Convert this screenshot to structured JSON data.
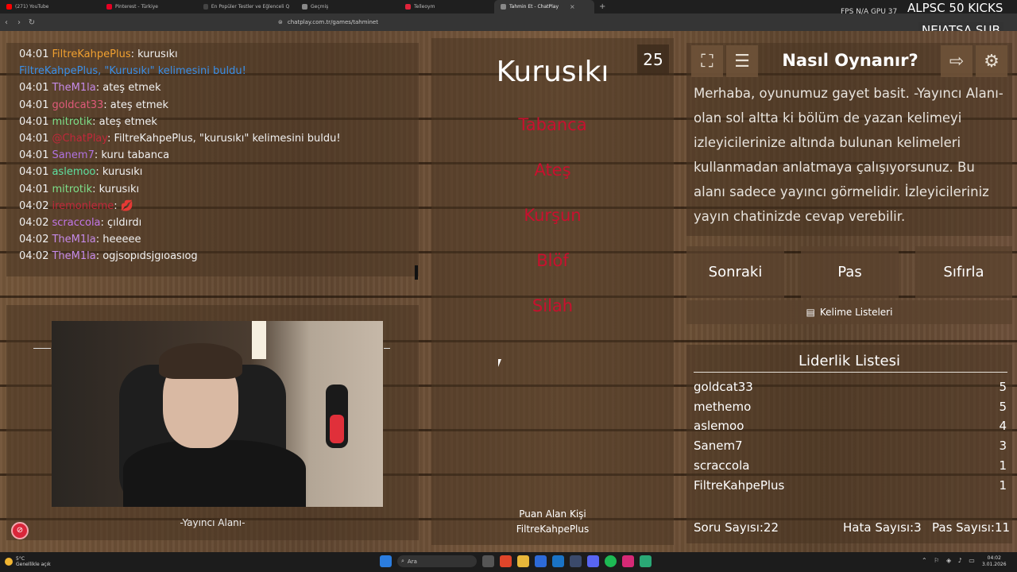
{
  "browser": {
    "tabs": [
      {
        "label": "(271) YouTube",
        "color": "#ff0000"
      },
      {
        "label": "Pinterest - Türkiye",
        "color": "#e60023"
      },
      {
        "label": "En Popüler Testler ve Eğlenceli Quizle...",
        "color": "#444444"
      },
      {
        "label": "Geçmiş",
        "color": "#888888"
      },
      {
        "label": "Telleoym",
        "color": "#e0233a"
      },
      {
        "label": "Tahmin Et - ChatPlay",
        "color": "#888888",
        "active": true
      }
    ],
    "url": "chatplay.com.tr/games/tahminet"
  },
  "overlay": {
    "fps_label": "FPS N/A GPU 37",
    "stream_title": "ALPSC 50 KICKS",
    "badge": "NEJATSA SUB"
  },
  "chat": {
    "messages": [
      {
        "time": "04:01",
        "user": "FiltreKahpePlus",
        "color": "#f0a030",
        "text": ": kurusıkı"
      },
      {
        "time": "",
        "user": "",
        "color": "#3a8ee6",
        "text": "FiltreKahpePlus, \"Kurusıkı\" kelimesini buldu!",
        "system": true
      },
      {
        "time": "04:01",
        "user": "TheM1la",
        "color": "#c58ae8",
        "text": ": ateş etmek"
      },
      {
        "time": "04:01",
        "user": "goldcat33",
        "color": "#e05a7a",
        "text": ": ateş etmek"
      },
      {
        "time": "04:01",
        "user": "mitrotik",
        "color": "#7ee08a",
        "text": ": ateş etmek"
      },
      {
        "time": "04:01",
        "user": "@ChatPlay",
        "color": "#c0283a",
        "text": ": FiltreKahpePlus, \"kurusıkı\" kelimesini buldu!"
      },
      {
        "time": "04:01",
        "user": "Sanem7",
        "color": "#b072e0",
        "text": ": kuru tabanca"
      },
      {
        "time": "04:01",
        "user": "aslemoo",
        "color": "#5ee0a0",
        "text": ": kurusıkı"
      },
      {
        "time": "04:01",
        "user": "mitrotik",
        "color": "#7ee08a",
        "text": ": kurusıkı"
      },
      {
        "time": "04:02",
        "user": "iremonleme",
        "color": "#c0283a",
        "text": ": 💋"
      },
      {
        "time": "04:02",
        "user": "scraccola",
        "color": "#c276e8",
        "text": ": çıldırdı"
      },
      {
        "time": "04:02",
        "user": "TheM1la",
        "color": "#c58ae8",
        "text": ": heeeee"
      },
      {
        "time": "04:02",
        "user": "TheM1la",
        "color": "#c58ae8",
        "text": ": ogjsopıdsjgıoasıog"
      }
    ]
  },
  "camera": {
    "label": "-Yayıncı Alanı-"
  },
  "game": {
    "word": "Kurusıkı",
    "timer": "25",
    "forbidden": [
      "Tabanca",
      "Ateş",
      "Kurşun",
      "Blöf",
      "Silah"
    ],
    "scorer_label": "Puan Alan Kişi",
    "scorer_name": "FiltreKahpePlus"
  },
  "howto": {
    "title": "Nasıl Oynanır?",
    "text": "Merhaba, oyunumuz gayet basit. -Yayıncı Alanı- olan sol altta ki bölüm de yazan kelimeyi izleyicilerinize altında bulunan kelimeleri kullanmadan anlatmaya çalışıyorsunuz. Bu alanı sadece yayıncı görmelidir. İzleyicileriniz yayın chatinizde cevap verebilir."
  },
  "actions": {
    "next": "Sonraki",
    "pass": "Pas",
    "reset": "Sıfırla",
    "wordlists": "Kelime Listeleri"
  },
  "leaderboard": {
    "title": "Liderlik Listesi",
    "rows": [
      {
        "name": "goldcat33",
        "score": "5"
      },
      {
        "name": "methemo",
        "score": "5"
      },
      {
        "name": "aslemoo",
        "score": "4"
      },
      {
        "name": "Sanem7",
        "score": "3"
      },
      {
        "name": "scraccola",
        "score": "1"
      },
      {
        "name": "FiltreKahpePlus",
        "score": "1"
      }
    ]
  },
  "stats": {
    "questions": "Soru Sayısı:22",
    "errors": "Hata Sayısı:3",
    "passes": "Pas Sayısı:11"
  },
  "taskbar": {
    "temp": "5°C",
    "weather": "Genellikle açık",
    "search": "Ara",
    "time": "04:02",
    "date": "3.01.2026"
  }
}
